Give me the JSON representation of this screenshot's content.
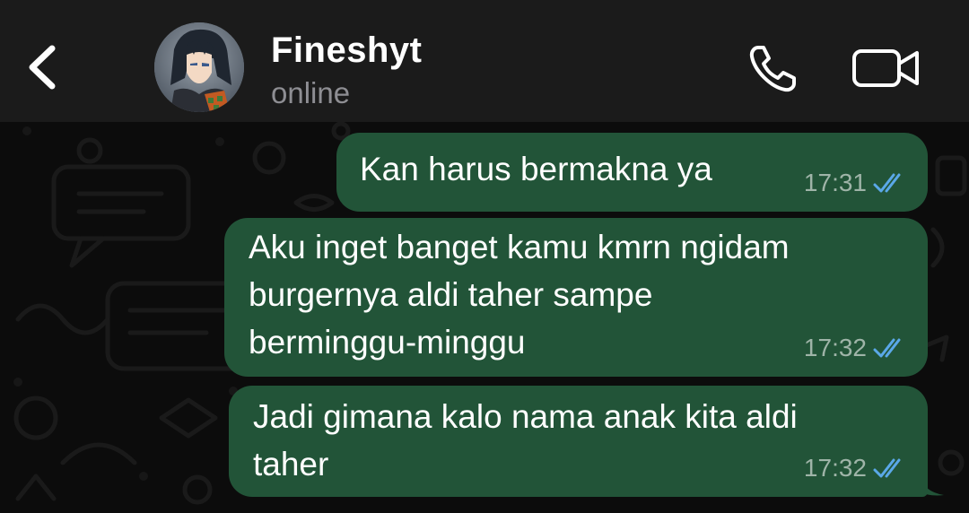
{
  "contact": {
    "name": "Fineshyt",
    "status": "online"
  },
  "messages": [
    {
      "text": "Kan harus bermakna ya",
      "time": "17:31",
      "status": "read"
    },
    {
      "text": "Aku inget banget kamu kmrn ngidam\nburgernya aldi taher sampe\nberminggu-minggu",
      "time": "17:32",
      "status": "read"
    },
    {
      "text": "Jadi gimana kalo nama anak kita aldi\ntaher",
      "time": "17:32",
      "status": "read"
    }
  ],
  "icons": {
    "back": "chevron-left-icon",
    "call": "phone-icon",
    "video": "video-camera-icon",
    "receipt": "double-check-icon"
  },
  "colors": {
    "header_bg": "#1b1b1b",
    "chat_bg": "#0c0c0c",
    "bubble_bg": "#225438",
    "read_tick": "#5aa8e8",
    "status_text": "#8e8e93"
  }
}
